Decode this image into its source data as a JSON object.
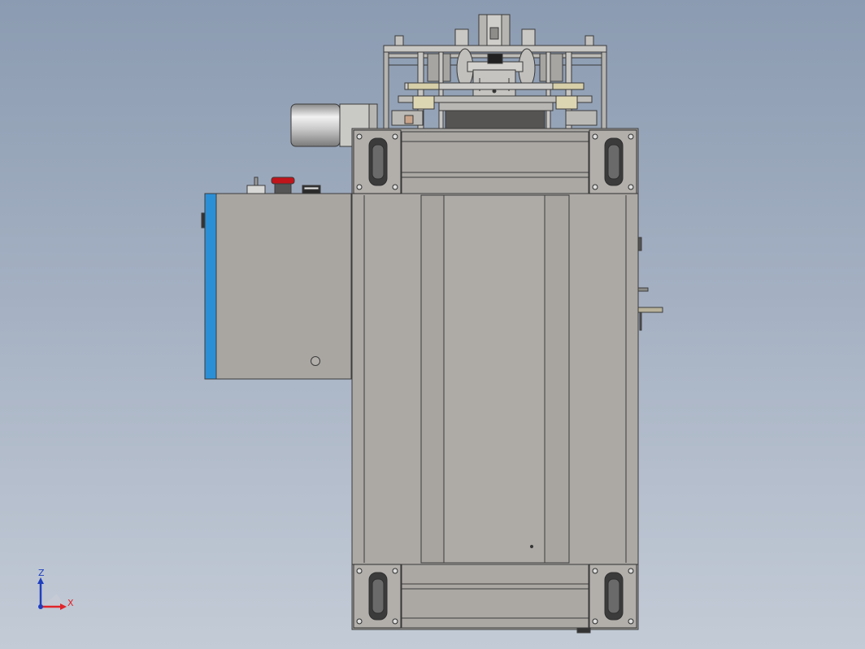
{
  "viewport": {
    "background_top": "#8b9bb1",
    "background_bottom": "#c3cbd6"
  },
  "model": {
    "frame_color": "#a9a6a2",
    "panel_color": "#aaa7a3",
    "edge_color": "#3c3c3c",
    "accent_blue": "#2b8fd6",
    "estop_red": "#c0141a"
  },
  "triad": {
    "x_label": "X",
    "z_label": "Z",
    "x_color": "#e0242a",
    "z_color": "#1f3fbf"
  }
}
